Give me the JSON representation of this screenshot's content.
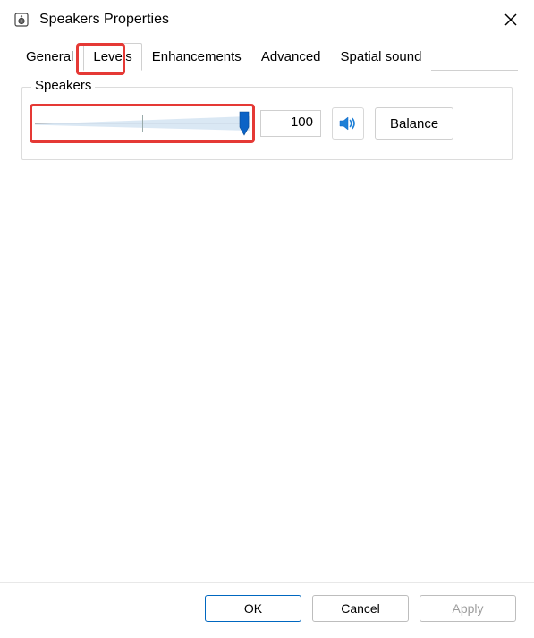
{
  "window": {
    "title": "Speakers Properties"
  },
  "tabs": {
    "general": "General",
    "levels": "Levels",
    "enhancements": "Enhancements",
    "advanced": "Advanced",
    "spatial": "Spatial sound",
    "active": "levels"
  },
  "groupbox": {
    "legend": "Speakers",
    "slider_value_percent": 100,
    "level_readout": "100",
    "balance_label": "Balance"
  },
  "footer": {
    "ok": "OK",
    "cancel": "Cancel",
    "apply": "Apply"
  },
  "icons": {
    "app": "speaker-device-icon",
    "close": "close-icon",
    "mute": "speaker-volume-icon"
  },
  "highlights": {
    "levels_tab": true,
    "slider": true
  },
  "colors": {
    "highlight": "#e53935",
    "accent": "#0067c0",
    "slider_fill": "#d6e5f3",
    "thumb": "#0b63c6"
  }
}
